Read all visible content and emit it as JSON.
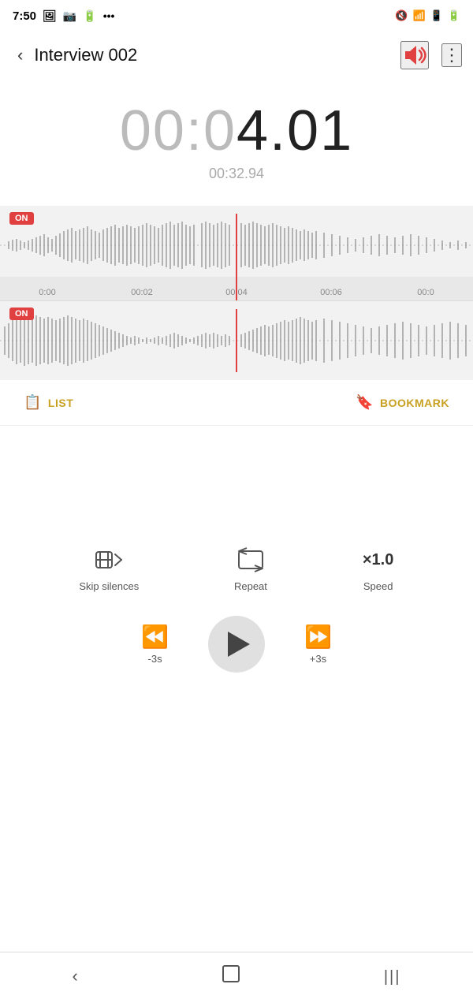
{
  "statusBar": {
    "time": "7:50",
    "icons": [
      "photo",
      "battery-saver",
      "battery",
      "more"
    ]
  },
  "topBar": {
    "backLabel": "‹",
    "title": "Interview 002",
    "volumeIconColor": "#e04040",
    "moreIcon": "⋮"
  },
  "timer": {
    "displayPrimary": "00:04.01",
    "displayPrimaryPrefix": "00:0",
    "displayPrimaryActive": "4.01",
    "displaySecondary": "00:32.94"
  },
  "tracks": [
    {
      "badge": "ON",
      "id": "track1"
    },
    {
      "badge": "ON",
      "id": "track2"
    }
  ],
  "timeline": {
    "labels": [
      "0:00",
      "00:02",
      "00:04",
      "00:06",
      "00:0"
    ]
  },
  "actions": [
    {
      "id": "list",
      "icon": "📋",
      "label": "LIST"
    },
    {
      "id": "bookmark",
      "icon": "🔖",
      "label": "BOOKMARK"
    }
  ],
  "controls": [
    {
      "id": "skip-silences",
      "label": "Skip silences"
    },
    {
      "id": "repeat",
      "label": "Repeat"
    },
    {
      "id": "speed",
      "label": "Speed",
      "value": "×1.0"
    }
  ],
  "playback": {
    "rewindLabel": "-3s",
    "forwardLabel": "+3s"
  },
  "bottomNav": {
    "back": "‹",
    "home": "□",
    "recent": "|||"
  }
}
